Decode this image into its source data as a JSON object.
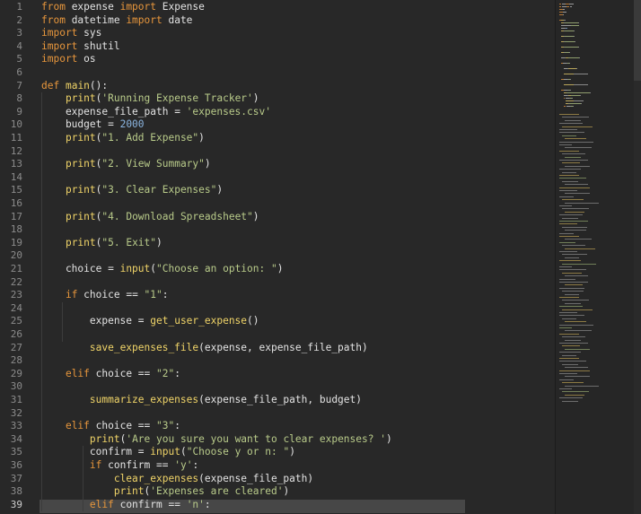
{
  "editor": {
    "language": "python",
    "first_line": 1,
    "current_line": 39,
    "colors": {
      "background": "#282828",
      "keyword": "#e7963c",
      "function": "#f0d468",
      "string": "#b9cb8a",
      "number": "#8bb5e0",
      "text": "#e3e3e3",
      "line_number": "#8c8c8c"
    },
    "lines": [
      [
        [
          "kw",
          "from"
        ],
        [
          "id",
          " expense "
        ],
        [
          "kw",
          "import"
        ],
        [
          "id",
          " Expense"
        ]
      ],
      [
        [
          "kw",
          "from"
        ],
        [
          "id",
          " datetime "
        ],
        [
          "kw",
          "import"
        ],
        [
          "id",
          " date"
        ]
      ],
      [
        [
          "kw",
          "import"
        ],
        [
          "id",
          " sys"
        ]
      ],
      [
        [
          "kw",
          "import"
        ],
        [
          "id",
          " shutil"
        ]
      ],
      [
        [
          "kw",
          "import"
        ],
        [
          "id",
          " os"
        ]
      ],
      [],
      [
        [
          "kw",
          "def"
        ],
        [
          "id",
          " "
        ],
        [
          "fn",
          "main"
        ],
        [
          "pl",
          "():"
        ]
      ],
      [
        [
          "id",
          "    "
        ],
        [
          "fn",
          "print"
        ],
        [
          "pl",
          "("
        ],
        [
          "str",
          "'Running Expense Tracker'"
        ],
        [
          "pl",
          ")"
        ]
      ],
      [
        [
          "id",
          "    expense_file_path "
        ],
        [
          "pl",
          "= "
        ],
        [
          "str",
          "'expenses.csv'"
        ]
      ],
      [
        [
          "id",
          "    budget "
        ],
        [
          "pl",
          "= "
        ],
        [
          "num",
          "2000"
        ]
      ],
      [
        [
          "id",
          "    "
        ],
        [
          "fn",
          "print"
        ],
        [
          "pl",
          "("
        ],
        [
          "str",
          "\"1. Add Expense\""
        ],
        [
          "pl",
          ")"
        ]
      ],
      [],
      [
        [
          "id",
          "    "
        ],
        [
          "fn",
          "print"
        ],
        [
          "pl",
          "("
        ],
        [
          "str",
          "\"2. View Summary\""
        ],
        [
          "pl",
          ")"
        ]
      ],
      [],
      [
        [
          "id",
          "    "
        ],
        [
          "fn",
          "print"
        ],
        [
          "pl",
          "("
        ],
        [
          "str",
          "\"3. Clear Expenses\""
        ],
        [
          "pl",
          ")"
        ]
      ],
      [],
      [
        [
          "id",
          "    "
        ],
        [
          "fn",
          "print"
        ],
        [
          "pl",
          "("
        ],
        [
          "str",
          "\"4. Download Spreadsheet\""
        ],
        [
          "pl",
          ")"
        ]
      ],
      [],
      [
        [
          "id",
          "    "
        ],
        [
          "fn",
          "print"
        ],
        [
          "pl",
          "("
        ],
        [
          "str",
          "\"5. Exit\""
        ],
        [
          "pl",
          ")"
        ]
      ],
      [],
      [
        [
          "id",
          "    choice "
        ],
        [
          "pl",
          "= "
        ],
        [
          "fn",
          "input"
        ],
        [
          "pl",
          "("
        ],
        [
          "str",
          "\"Choose an option: \""
        ],
        [
          "pl",
          ")"
        ]
      ],
      [],
      [
        [
          "id",
          "    "
        ],
        [
          "kw",
          "if"
        ],
        [
          "id",
          " choice "
        ],
        [
          "pl",
          "== "
        ],
        [
          "str",
          "\"1\""
        ],
        [
          "pl",
          ":"
        ]
      ],
      [],
      [
        [
          "id",
          "        expense "
        ],
        [
          "pl",
          "= "
        ],
        [
          "fn",
          "get_user_expense"
        ],
        [
          "pl",
          "()"
        ]
      ],
      [],
      [
        [
          "id",
          "        "
        ],
        [
          "fn",
          "save_expenses_file"
        ],
        [
          "pl",
          "(expense, expense_file_path)"
        ]
      ],
      [],
      [
        [
          "id",
          "    "
        ],
        [
          "kw",
          "elif"
        ],
        [
          "id",
          " choice "
        ],
        [
          "pl",
          "== "
        ],
        [
          "str",
          "\"2\""
        ],
        [
          "pl",
          ":"
        ]
      ],
      [],
      [
        [
          "id",
          "        "
        ],
        [
          "fn",
          "summarize_expenses"
        ],
        [
          "pl",
          "(expense_file_path, budget)"
        ]
      ],
      [],
      [
        [
          "id",
          "    "
        ],
        [
          "kw",
          "elif"
        ],
        [
          "id",
          " choice "
        ],
        [
          "pl",
          "== "
        ],
        [
          "str",
          "\"3\""
        ],
        [
          "pl",
          ":"
        ]
      ],
      [
        [
          "id",
          "        "
        ],
        [
          "fn",
          "print"
        ],
        [
          "pl",
          "("
        ],
        [
          "str",
          "'Are you sure you want to clear expenses? '"
        ],
        [
          "pl",
          ")"
        ]
      ],
      [
        [
          "id",
          "        confirm "
        ],
        [
          "pl",
          "= "
        ],
        [
          "fn",
          "input"
        ],
        [
          "pl",
          "("
        ],
        [
          "str",
          "\"Choose y or n: \""
        ],
        [
          "pl",
          ")"
        ]
      ],
      [
        [
          "id",
          "        "
        ],
        [
          "kw",
          "if"
        ],
        [
          "id",
          " confirm "
        ],
        [
          "pl",
          "== "
        ],
        [
          "str",
          "'y'"
        ],
        [
          "pl",
          ":"
        ]
      ],
      [
        [
          "id",
          "            "
        ],
        [
          "fn",
          "clear_expenses"
        ],
        [
          "pl",
          "(expense_file_path)"
        ]
      ],
      [
        [
          "id",
          "            "
        ],
        [
          "fn",
          "print"
        ],
        [
          "pl",
          "("
        ],
        [
          "str",
          "'Expenses are cleared'"
        ],
        [
          "pl",
          ")"
        ]
      ],
      [
        [
          "id",
          "        "
        ],
        [
          "kw",
          "elif"
        ],
        [
          "id",
          " confirm "
        ],
        [
          "pl",
          "== "
        ],
        [
          "str",
          "'n'"
        ],
        [
          "pl",
          ":"
        ]
      ]
    ]
  },
  "minimap": {
    "visible": true
  },
  "scrollbar": {
    "visible": true
  }
}
